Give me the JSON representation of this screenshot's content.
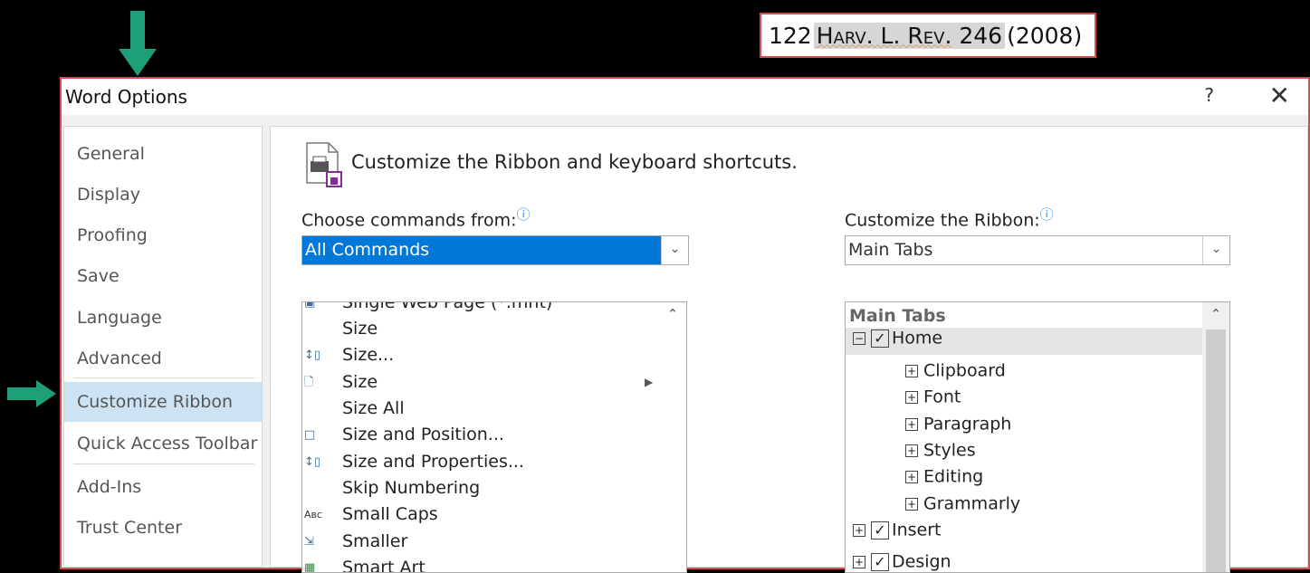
{
  "citation": {
    "volume": "122",
    "journal": "Harv. L. Rev.",
    "page": "246",
    "year": "(2008)"
  },
  "dialog": {
    "title": "Word Options",
    "help_glyph": "?",
    "close_glyph": "✕"
  },
  "nav": {
    "items": [
      {
        "label": "General"
      },
      {
        "label": "Display"
      },
      {
        "label": "Proofing"
      },
      {
        "label": "Save"
      },
      {
        "label": "Language"
      },
      {
        "label": "Advanced"
      },
      {
        "label": "Customize Ribbon",
        "selected": true
      },
      {
        "label": "Quick Access Toolbar"
      },
      {
        "label": "Add-Ins"
      },
      {
        "label": "Trust Center"
      }
    ]
  },
  "main": {
    "heading": "Customize the Ribbon and keyboard shortcuts.",
    "choose_label": "Choose commands from:",
    "choose_value": "All Commands",
    "customize_label": "Customize the Ribbon:",
    "customize_value": "Main Tabs",
    "info_glyph": "ⓘ",
    "commands": [
      {
        "label": "Single Web Page (*.mht)",
        "icon": "web-page-icon"
      },
      {
        "label": "Size",
        "icon": ""
      },
      {
        "label": "Size...",
        "icon": "size-dialog-icon"
      },
      {
        "label": "Size",
        "icon": "page-size-icon",
        "submenu": true
      },
      {
        "label": "Size All",
        "icon": ""
      },
      {
        "label": "Size and Position...",
        "icon": "size-position-icon"
      },
      {
        "label": "Size and Properties...",
        "icon": "size-properties-icon"
      },
      {
        "label": "Skip Numbering",
        "icon": ""
      },
      {
        "label": "Small Caps",
        "icon": "small-caps-icon"
      },
      {
        "label": "Smaller",
        "icon": "smaller-icon"
      },
      {
        "label": "Smart Art",
        "icon": "smartart-icon"
      }
    ],
    "tree": {
      "header": "Main Tabs",
      "rows": [
        {
          "label": "Home",
          "level": 0,
          "expanded": true,
          "checked": true
        },
        {
          "label": "Clipboard",
          "level": 1
        },
        {
          "label": "Font",
          "level": 1
        },
        {
          "label": "Paragraph",
          "level": 1
        },
        {
          "label": "Styles",
          "level": 1
        },
        {
          "label": "Editing",
          "level": 1
        },
        {
          "label": "Grammarly",
          "level": 1
        },
        {
          "label": "Insert",
          "level": 0,
          "expanded": false,
          "checked": true
        },
        {
          "label": "Design",
          "level": 0,
          "expanded": false,
          "checked": true
        }
      ]
    }
  },
  "colors": {
    "accent_green": "#1f9e7a",
    "selection_blue": "#0078d7",
    "nav_selected": "#cce3f3",
    "highlight_border": "#d94b4b"
  }
}
